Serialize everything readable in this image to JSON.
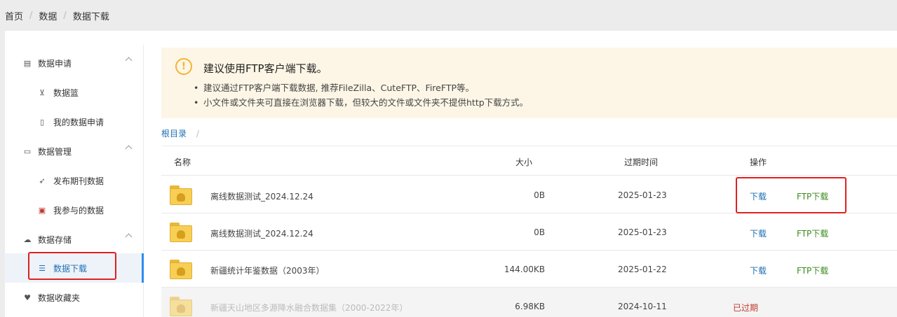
{
  "breadcrumb": {
    "items": [
      "首页",
      "数据",
      "数据下载"
    ],
    "separator": "/"
  },
  "sidebar": {
    "groups": [
      {
        "label": "数据申请",
        "icon": "clipboard-icon",
        "items": [
          {
            "label": "数据篮",
            "icon": "cart-icon"
          },
          {
            "label": "我的数据申请",
            "icon": "document-icon"
          }
        ]
      },
      {
        "label": "数据管理",
        "icon": "monitor-icon",
        "items": [
          {
            "label": "发布期刊数据",
            "icon": "rocket-icon"
          },
          {
            "label": "我参与的数据",
            "icon": "wallet-icon"
          }
        ]
      },
      {
        "label": "数据存储",
        "icon": "cloud-icon",
        "items": [
          {
            "label": "数据下载",
            "icon": "list-icon",
            "active": true
          }
        ]
      }
    ],
    "favorites": {
      "label": "数据收藏夹",
      "icon": "heart-icon"
    }
  },
  "notice": {
    "title": "建议使用FTP客户端下载。",
    "bullets": [
      "建议通过FTP客户端下载数据, 推荐FileZilla、CuteFTP、FireFTP等。",
      "小文件或文件夹可直接在浏览器下载，但较大的文件或文件夹不提供http下载方式。"
    ]
  },
  "path": {
    "root": "根目录",
    "separator": "/"
  },
  "table": {
    "headers": {
      "name": "名称",
      "size": "大小",
      "expire": "过期时间",
      "ops": "操作"
    },
    "rows": [
      {
        "name": "离线数据测试_2024.12.24",
        "size": "0B",
        "expire": "2025-01-23",
        "download": "下载",
        "ftp": "FTP下载"
      },
      {
        "name": "离线数据测试_2024.12.24",
        "size": "0B",
        "expire": "2025-01-23",
        "download": "下载",
        "ftp": "FTP下载"
      },
      {
        "name": "新疆统计年鉴数据（2003年）",
        "size": "144.00KB",
        "expire": "2025-01-22",
        "download": "下载",
        "ftp": "FTP下载"
      },
      {
        "name": "新疆天山地区多源降水融合数据集（2000-2022年）",
        "size": "6.98KB",
        "expire": "2024-10-11",
        "status": "已过期"
      }
    ]
  },
  "colors": {
    "accent": "#1f6fb5",
    "ftp": "#3c8b1e",
    "expired": "#c0392b",
    "highlight": "#e02020",
    "notice_bg": "#fdf6e6"
  }
}
